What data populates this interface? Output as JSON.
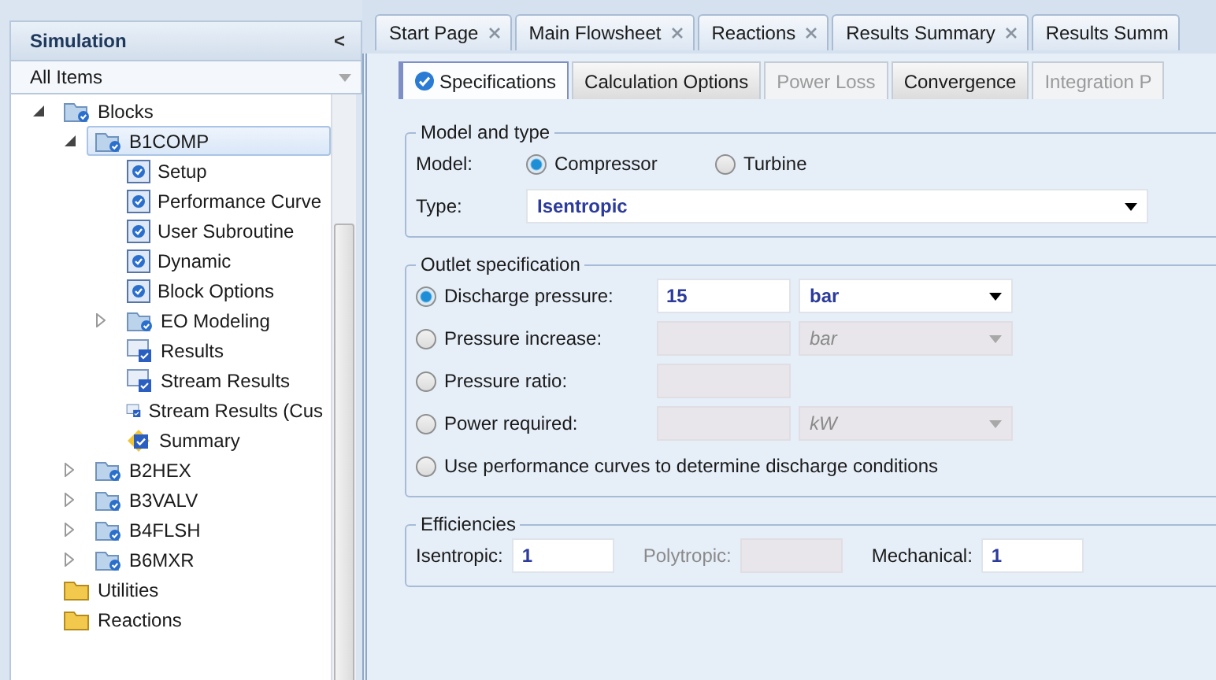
{
  "sidebar": {
    "title": "Simulation",
    "collapse": "<",
    "filter": "All Items",
    "tree": [
      {
        "label": "Blocks",
        "kind": "folder-check",
        "expanded": true,
        "selected": false,
        "children": [
          {
            "label": "B1COMP",
            "kind": "folder-check",
            "expanded": true,
            "selected": true,
            "children": [
              {
                "label": "Setup",
                "kind": "form",
                "selected": false
              },
              {
                "label": "Performance Curve",
                "kind": "form",
                "selected": false
              },
              {
                "label": "User Subroutine",
                "kind": "form",
                "selected": false
              },
              {
                "label": "Dynamic",
                "kind": "form",
                "selected": false
              },
              {
                "label": "Block Options",
                "kind": "form",
                "selected": false
              },
              {
                "label": "EO Modeling",
                "kind": "folder-check",
                "expanded": false,
                "selected": false
              },
              {
                "label": "Results",
                "kind": "results",
                "selected": false
              },
              {
                "label": "Stream Results",
                "kind": "results",
                "selected": false
              },
              {
                "label": "Stream Results (Cus",
                "kind": "results",
                "selected": false
              },
              {
                "label": "Summary",
                "kind": "summary",
                "selected": false
              }
            ]
          },
          {
            "label": "B2HEX",
            "kind": "folder-check",
            "expanded": false,
            "selected": false
          },
          {
            "label": "B3VALV",
            "kind": "folder-check",
            "expanded": false,
            "selected": false
          },
          {
            "label": "B4FLSH",
            "kind": "folder-check",
            "expanded": false,
            "selected": false
          },
          {
            "label": "B6MXR",
            "kind": "folder-check",
            "expanded": false,
            "selected": false
          }
        ]
      },
      {
        "label": "Utilities",
        "kind": "folder",
        "selected": false
      },
      {
        "label": "Reactions",
        "kind": "folder",
        "selected": false
      }
    ]
  },
  "doc_tabs": [
    {
      "label": "Start Page",
      "closable": true
    },
    {
      "label": "Main Flowsheet",
      "closable": true
    },
    {
      "label": "Reactions",
      "closable": true
    },
    {
      "label": "Results Summary",
      "closable": true
    },
    {
      "label": "Results Summ",
      "closable": false
    }
  ],
  "form_tabs": [
    {
      "label": "Specifications",
      "selected": true,
      "disabled": false,
      "complete": true
    },
    {
      "label": "Calculation Options",
      "selected": false,
      "disabled": false,
      "complete": false
    },
    {
      "label": "Power Loss",
      "selected": false,
      "disabled": true,
      "complete": false
    },
    {
      "label": "Convergence",
      "selected": false,
      "disabled": false,
      "complete": false
    },
    {
      "label": "Integration P",
      "selected": false,
      "disabled": true,
      "complete": false
    }
  ],
  "model_and_type": {
    "title": "Model and type",
    "model_label": "Model:",
    "models": [
      {
        "label": "Compressor",
        "selected": true
      },
      {
        "label": "Turbine",
        "selected": false
      }
    ],
    "type_label": "Type:",
    "type_value": "Isentropic"
  },
  "outlet_specification": {
    "title": "Outlet specification",
    "options": [
      {
        "kind": "value-unit",
        "label": "Discharge pressure:",
        "selected": true,
        "disabled": false,
        "value": "15",
        "unit": "bar"
      },
      {
        "kind": "value-unit",
        "label": "Pressure increase:",
        "selected": false,
        "disabled": true,
        "unit": "bar"
      },
      {
        "kind": "value",
        "label": "Pressure ratio:",
        "selected": false,
        "disabled": true
      },
      {
        "kind": "value-unit",
        "label": "Power required:",
        "selected": false,
        "disabled": true,
        "unit": "kW"
      },
      {
        "kind": "plain",
        "label": "Use performance curves to determine discharge conditions",
        "selected": false
      }
    ]
  },
  "efficiencies": {
    "title": "Efficiencies",
    "fields": [
      {
        "label": "Isentropic:",
        "value": "1",
        "disabled": false
      },
      {
        "label": "Polytropic:",
        "disabled": true
      },
      {
        "label": "Mechanical:",
        "value": "1",
        "disabled": false
      }
    ]
  }
}
